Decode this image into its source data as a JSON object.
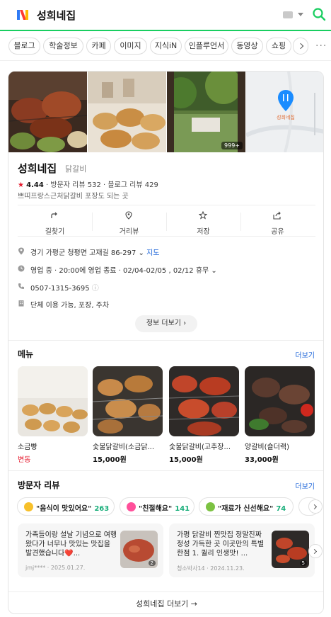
{
  "header": {
    "query": "성희네집"
  },
  "tabs": [
    {
      "label": "블로그"
    },
    {
      "label": "학술정보"
    },
    {
      "label": "카페"
    },
    {
      "label": "이미지"
    },
    {
      "label": "지식iN"
    },
    {
      "label": "인플루언서"
    },
    {
      "label": "동영상"
    },
    {
      "label": "쇼핑"
    }
  ],
  "place": {
    "name": "성희네집",
    "category": "닭갈비",
    "photo_count": "999+",
    "map_label": "성희네집",
    "rating": "4.44",
    "visitor_reviews": "방문자 리뷰 532",
    "blog_reviews": "블로그 리뷰 429",
    "description": "쁘띠프랑스근처닭갈비 포장도 되는 곳",
    "actions": [
      {
        "label": "길찾기",
        "icon": "directions-icon"
      },
      {
        "label": "거리뷰",
        "icon": "street-view-icon"
      },
      {
        "label": "저장",
        "icon": "star-icon"
      },
      {
        "label": "공유",
        "icon": "share-icon"
      }
    ],
    "address": "경기 가평군 청평면 고재길 86-297",
    "map_link": "지도",
    "status": "영업 중",
    "hours_rest": "· 20:00에 영업 종료 · 02/04-02/05 , 02/12 휴무",
    "phone": "0507-1315-3695",
    "amenities": "단체 이용 가능, 포장, 주차",
    "more_info": "정보 더보기"
  },
  "menu": {
    "title": "메뉴",
    "more": "더보기",
    "items": [
      {
        "name": "소금빵",
        "price": "변동"
      },
      {
        "name": "숯불닭갈비(소금닭...",
        "price": "15,000원"
      },
      {
        "name": "숯불닭갈비(고추장...",
        "price": "15,000원"
      },
      {
        "name": "양갈비(숄더랙)",
        "price": "33,000원"
      }
    ]
  },
  "reviews": {
    "title": "방문자 리뷰",
    "more": "더보기",
    "chips": [
      {
        "text": "\"음식이 맛있어요\"",
        "count": "263"
      },
      {
        "text": "\"친절해요\"",
        "count": "141"
      },
      {
        "text": "\"재료가 신선해요\"",
        "count": "74"
      }
    ],
    "cards": [
      {
        "text": "가족들이랑 설날 기념으로 여행 왔다가 너무나 맛있는 맛집을 발견했습니다❤️...",
        "author": "jmj****",
        "date": "· 2025.01.27.",
        "photos": "2"
      },
      {
        "text": "가평 닭갈비 찐맛집 정말진짜 정성 가득한 곳 이곳만의 특별한점 1. 퀄리 인생맛! ...",
        "author": "청소박사14",
        "date": "· 2024.11.23.",
        "photos": "5"
      }
    ]
  },
  "footer": {
    "more_label": "성희네집 더보기 →"
  },
  "colors": {
    "accent_green": "#19ce60",
    "link_blue": "#1a63d8",
    "star_red": "#e6192d",
    "count_green": "#19ae7a"
  }
}
